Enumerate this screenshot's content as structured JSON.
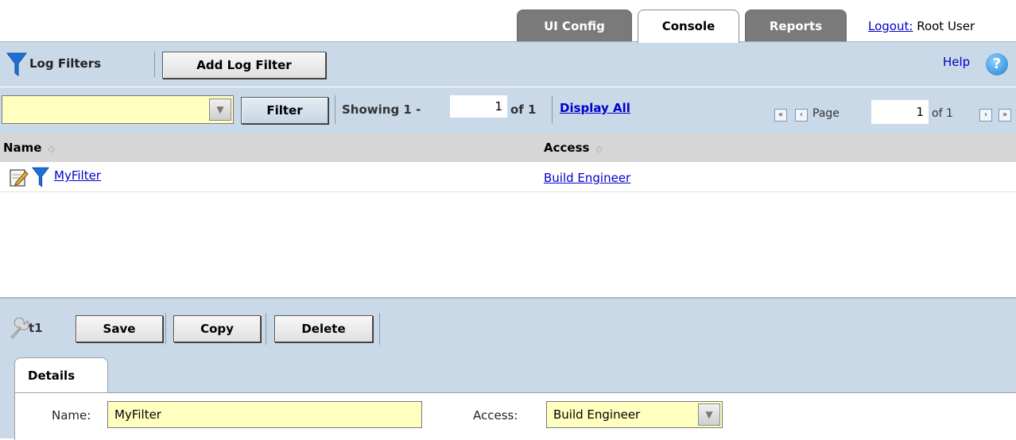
{
  "tabs": [
    {
      "label": "UI Config",
      "active": false
    },
    {
      "label": "Console",
      "active": true
    },
    {
      "label": "Reports",
      "active": false
    }
  ],
  "user": {
    "logout_label": "Logout:",
    "name": "Root User"
  },
  "toolbar": {
    "section_title": "Log Filters",
    "add_button": "Add Log Filter",
    "help_label": "Help",
    "help_icon_glyph": "?"
  },
  "filter_bar": {
    "combo_value": "",
    "filter_button": "Filter",
    "showing_label": "Showing 1 -",
    "showing_to": "1",
    "of_label": "of 1",
    "display_all": "Display All",
    "page_label": "Page",
    "page_value": "1",
    "page_of": "of 1",
    "first_glyph": "«",
    "prev_glyph": "‹",
    "next_glyph": "›",
    "last_glyph": "»"
  },
  "table": {
    "columns": [
      "Name",
      "Access"
    ],
    "sort_glyph": "◇",
    "rows": [
      {
        "name": "MyFilter",
        "access": "Build Engineer"
      }
    ]
  },
  "editor": {
    "record_label": "t1",
    "save": "Save",
    "copy": "Copy",
    "delete": "Delete",
    "details_tab": "Details",
    "name_label": "Name:",
    "name_value": "MyFilter",
    "access_label": "Access:",
    "access_value": "Build Engineer"
  },
  "colors": {
    "panel": "#c9d9e8",
    "input_bg": "#ffffc0",
    "link": "#0000cc",
    "tab_inactive": "#7a7a7a",
    "header_row": "#d6d6d6"
  }
}
